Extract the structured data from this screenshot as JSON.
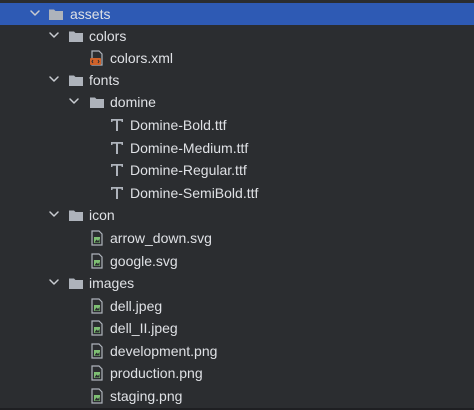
{
  "tree": {
    "rows": [
      {
        "label": "assets",
        "kind": "folder",
        "expanded": true,
        "selected": true
      },
      {
        "label": "colors",
        "kind": "folder",
        "expanded": true
      },
      {
        "label": "colors.xml",
        "kind": "xml-file"
      },
      {
        "label": "fonts",
        "kind": "folder",
        "expanded": true
      },
      {
        "label": "domine",
        "kind": "folder",
        "expanded": true
      },
      {
        "label": "Domine-Bold.ttf",
        "kind": "font-file"
      },
      {
        "label": "Domine-Medium.ttf",
        "kind": "font-file"
      },
      {
        "label": "Domine-Regular.ttf",
        "kind": "font-file"
      },
      {
        "label": "Domine-SemiBold.ttf",
        "kind": "font-file"
      },
      {
        "label": "icon",
        "kind": "folder",
        "expanded": true
      },
      {
        "label": "arrow_down.svg",
        "kind": "image-file"
      },
      {
        "label": "google.svg",
        "kind": "image-file"
      },
      {
        "label": "images",
        "kind": "folder",
        "expanded": true
      },
      {
        "label": "dell.jpeg",
        "kind": "image-file"
      },
      {
        "label": "dell_II.jpeg",
        "kind": "image-file"
      },
      {
        "label": "development.png",
        "kind": "image-file"
      },
      {
        "label": "production.png",
        "kind": "image-file"
      },
      {
        "label": "staging.png",
        "kind": "image-file"
      }
    ]
  },
  "colors": {
    "background": "#2b2d30",
    "selection": "#2e5ab4",
    "text": "#dfe1e5",
    "folder": "#aeb3bb",
    "xml_badge": "#d0622a",
    "image_file": "#7ebf73"
  }
}
